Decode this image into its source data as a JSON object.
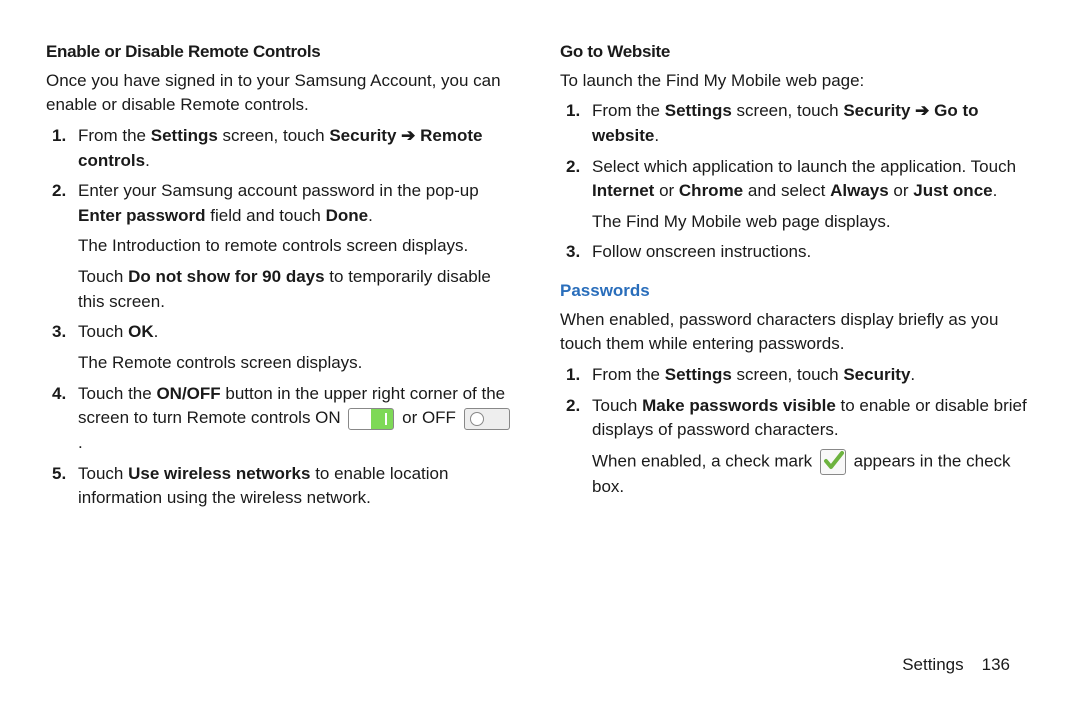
{
  "left": {
    "heading": "Enable or Disable Remote Controls",
    "intro": "Once you have signed in to your Samsung Account, you can enable or disable Remote controls.",
    "step1_a": "From the ",
    "step1_b": "Settings",
    "step1_c": " screen, touch ",
    "step1_d": "Security",
    "arrow": " ➔ ",
    "step1_e": "Remote controls",
    "step1_f": ".",
    "step2_a": "Enter your Samsung account password in the pop-up ",
    "step2_b": "Enter password",
    "step2_c": " field and touch ",
    "step2_d": "Done",
    "step2_e": ".",
    "step2_sub1": "The Introduction to remote controls screen displays.",
    "step2_sub2_a": "Touch ",
    "step2_sub2_b": "Do not show for 90 days",
    "step2_sub2_c": " to temporarily disable this screen.",
    "step3_a": "Touch ",
    "step3_b": "OK",
    "step3_c": ".",
    "step3_sub": "The Remote controls screen displays.",
    "step4_a": "Touch the ",
    "step4_b": "ON/OFF",
    "step4_c": " button in the upper right corner of the screen to turn Remote controls ON ",
    "step4_d": " or OFF ",
    "step4_e": " .",
    "step5_a": "Touch ",
    "step5_b": "Use wireless networks",
    "step5_c": " to enable location information using the wireless network."
  },
  "right": {
    "heading1": "Go to Website",
    "intro1": "To launch the Find My Mobile web page:",
    "s1_a": "From the ",
    "s1_b": "Settings",
    "s1_c": " screen, touch ",
    "s1_d": "Security",
    "arrow": " ➔ ",
    "s1_e": "Go to website",
    "s1_f": ".",
    "s2_a": "Select which application to launch the application. Touch ",
    "s2_b": "Internet",
    "s2_c": " or ",
    "s2_d": "Chrome",
    "s2_e": " and select ",
    "s2_f": "Always",
    "s2_g": " or ",
    "s2_h": "Just once",
    "s2_i": ".",
    "s2_sub": "The Find My Mobile web page displays.",
    "s3": "Follow onscreen instructions.",
    "heading2": "Passwords",
    "intro2": "When enabled, password characters display briefly as you touch them while entering passwords.",
    "p1_a": "From the ",
    "p1_b": "Settings",
    "p1_c": " screen, touch ",
    "p1_d": "Security",
    "p1_e": ".",
    "p2_a": "Touch ",
    "p2_b": "Make passwords visible",
    "p2_c": " to enable or disable brief displays of password characters.",
    "p2_sub_a": "When enabled, a check mark ",
    "p2_sub_b": " appears in the check box."
  },
  "footer": {
    "label": "Settings",
    "page": "136"
  }
}
